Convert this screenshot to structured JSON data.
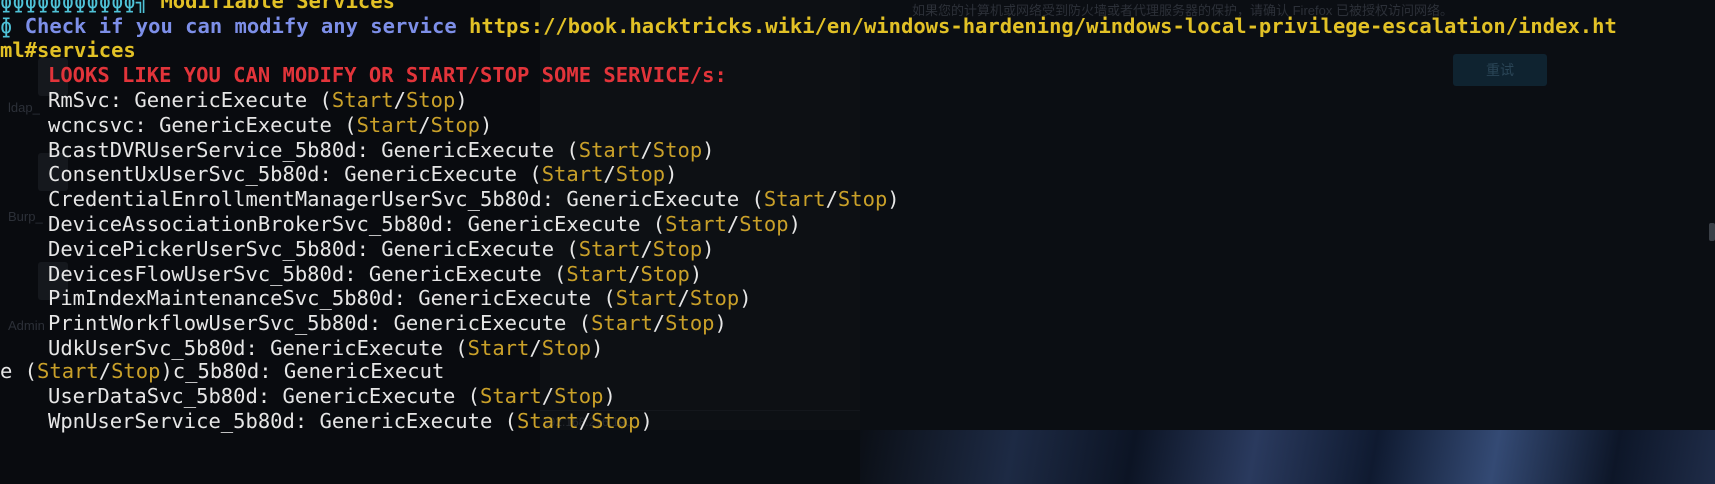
{
  "background": {
    "notice_text": "如果您的计算机或网络受到防火墙或者代理服务器的保护，请确认 Firefox 已被授权访问网络。",
    "retry_button": "重试",
    "desktop_labels": [
      "ldap_",
      "Burp_",
      "Admin"
    ],
    "address_hint": "192.168.216.190"
  },
  "terminal": {
    "section_title": "Modifiable Services",
    "check_prefix": "Check if you can modify any service",
    "check_url_part1": "https://book.hacktricks.wiki/en/windows-hardening/windows-local-privilege-escalation/index.ht",
    "check_url_part2": "ml#services",
    "warning": "LOOKS LIKE YOU CAN MODIFY OR START/STOP SOME SERVICE/s:",
    "permission": "GenericExecute",
    "start_label": "Start",
    "stop_label": "Stop",
    "services": [
      "RmSvc",
      "wcncsvc",
      "BcastDVRUserService_5b80d",
      "ConsentUxUserSvc_5b80d",
      "CredentialEnrollmentManagerUserSvc_5b80d",
      "DeviceAssociationBrokerSvc_5b80d",
      "DevicePickerUserSvc_5b80d",
      "DevicesFlowUserSvc_5b80d",
      "PimIndexMaintenanceSvc_5b80d",
      "PrintWorkflowUserSvc_5b80d",
      "UdkUserSvc_5b80d"
    ],
    "glitch_line": {
      "prefix": "e (",
      "start": "Start",
      "slash": "/",
      "stop": "Stop",
      "suffix": ")c_5b80d: GenericExecut"
    },
    "services_after": [
      "UserDataSvc_5b80d",
      "WpnUserService_5b80d"
    ]
  }
}
